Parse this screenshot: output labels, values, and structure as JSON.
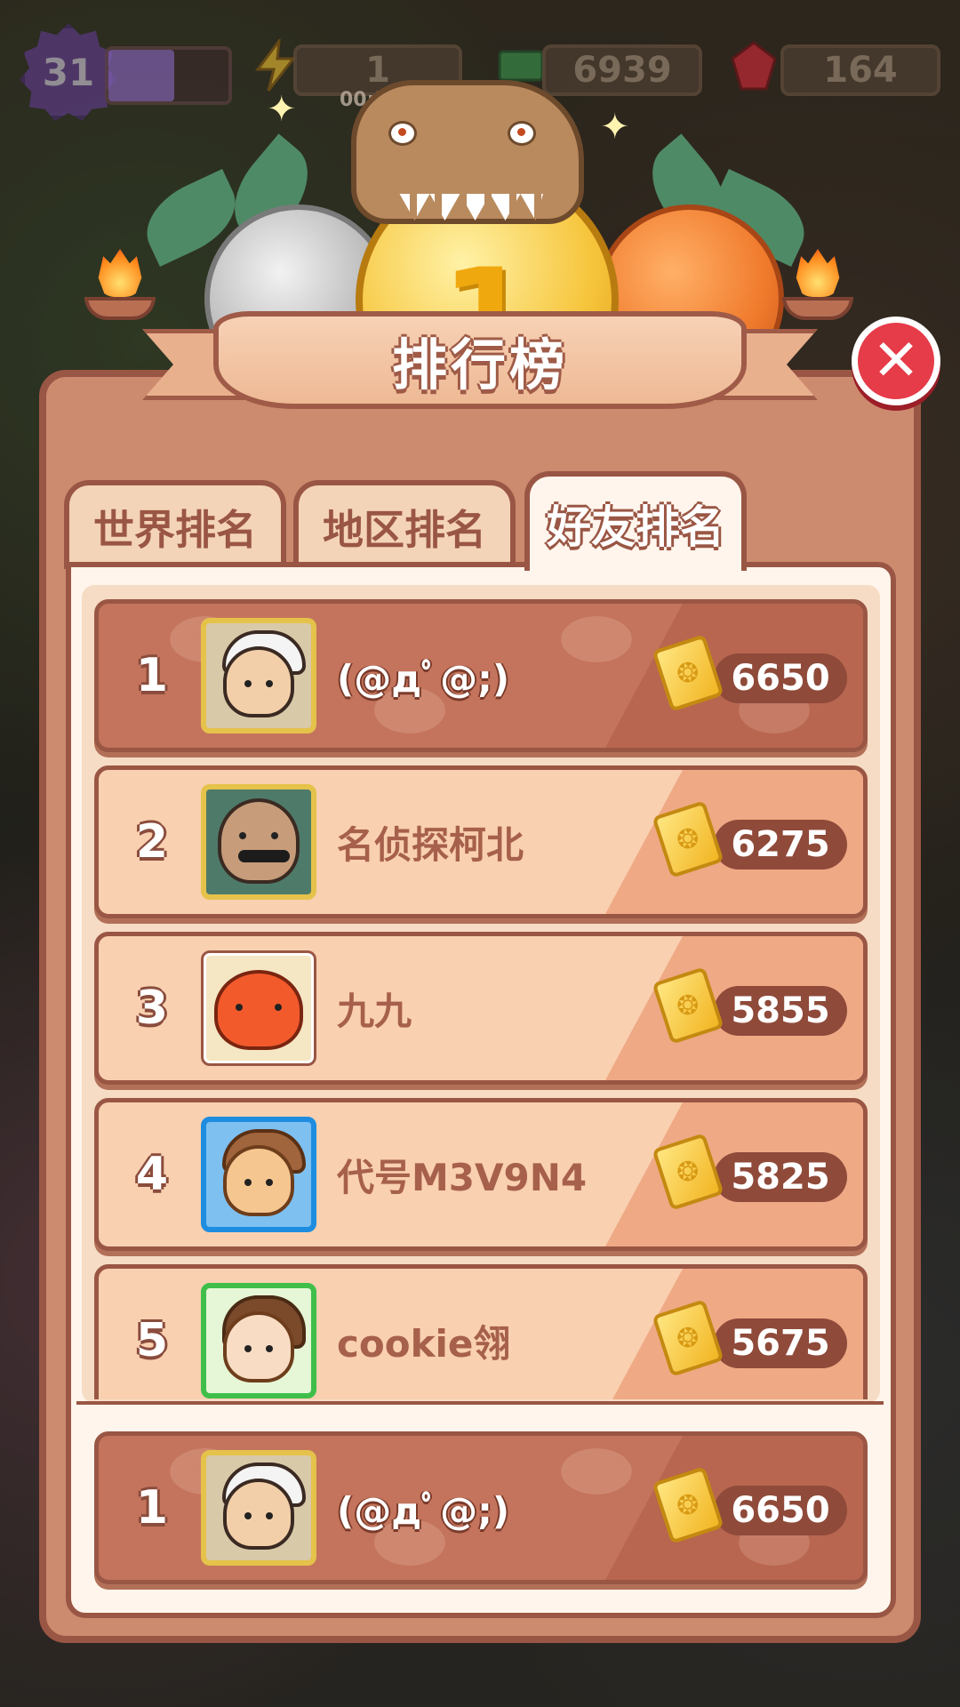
{
  "hud": {
    "level": "31",
    "xp_progress": 0.55,
    "energy": "1",
    "timer": "00:55",
    "cash": "6939",
    "gems": "164"
  },
  "title": "排行榜",
  "close_symbol": "✕",
  "tabs": [
    {
      "label": "世界排名",
      "active": false
    },
    {
      "label": "地区排名",
      "active": false
    },
    {
      "label": "好友排名",
      "active": true
    }
  ],
  "entries": [
    {
      "rank": "1",
      "name": "(@дﾟ@;)",
      "score": "6650",
      "avatar": "white-hat-boy"
    },
    {
      "rank": "2",
      "name": "名侦探柯北",
      "score": "6275",
      "avatar": "bald-sunglasses-man"
    },
    {
      "rank": "3",
      "name": "九九",
      "score": "5855",
      "avatar": "red-dragon"
    },
    {
      "rank": "4",
      "name": "代号M3V9N4",
      "score": "5825",
      "avatar": "hamster-hat"
    },
    {
      "rank": "5",
      "name": "cookie翎",
      "score": "5675",
      "avatar": "bride-girl"
    }
  ],
  "me": {
    "rank": "1",
    "name": "(@дﾟ@;)",
    "score": "6650",
    "avatar": "white-hat-boy"
  },
  "icons": {
    "coin_ticket": "ticket-icon",
    "ticket_glyph": "❂"
  },
  "colors": {
    "panel": "#cc8a6e",
    "border": "#9a5644",
    "close": "#e63b48"
  }
}
